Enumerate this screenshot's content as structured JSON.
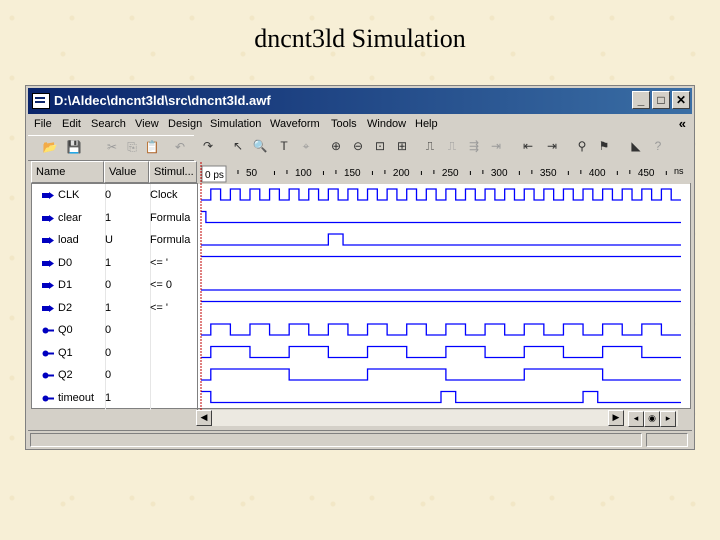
{
  "slide": {
    "title": "dncnt3ld Simulation"
  },
  "window": {
    "title": "D:\\Aldec\\dncnt3ld\\src\\dncnt3ld.awf",
    "buttons": {
      "minimize": "_",
      "maximize": "□",
      "close": "✕"
    }
  },
  "menu": [
    "File",
    "Edit",
    "Search",
    "View",
    "Design",
    "Simulation",
    "Waveform",
    "Tools",
    "Window",
    "Help"
  ],
  "menu_overflow": "«",
  "columns": {
    "name": "Name",
    "value": "Value",
    "stimulus": "Stimul..."
  },
  "timeline": {
    "cursor_label": "0 ps",
    "ticks": [
      "50",
      "100",
      "150",
      "200",
      "250",
      "300",
      "350",
      "400",
      "450"
    ],
    "unit": "ns"
  },
  "signals": [
    {
      "name": "CLK",
      "value": "0",
      "stimulus": "Clock",
      "direction": "in"
    },
    {
      "name": "clear",
      "value": "1",
      "stimulus": "Formula",
      "direction": "in"
    },
    {
      "name": "load",
      "value": "U",
      "stimulus": "Formula",
      "direction": "in"
    },
    {
      "name": "D0",
      "value": "1",
      "stimulus": "<= '",
      "direction": "in"
    },
    {
      "name": "D1",
      "value": "0",
      "stimulus": "<= 0",
      "direction": "in"
    },
    {
      "name": "D2",
      "value": "1",
      "stimulus": "<= '",
      "direction": "in"
    },
    {
      "name": "Q0",
      "value": "0",
      "stimulus": "",
      "direction": "out"
    },
    {
      "name": "Q1",
      "value": "0",
      "stimulus": "",
      "direction": "out"
    },
    {
      "name": "Q2",
      "value": "0",
      "stimulus": "",
      "direction": "out"
    },
    {
      "name": "timeout",
      "value": "1",
      "stimulus": "",
      "direction": "out"
    }
  ],
  "waveforms": {
    "time_range_ns": [
      0,
      490
    ],
    "CLK": {
      "type": "clock",
      "period_ns": 20,
      "start_level": 0
    },
    "clear": {
      "type": "edges",
      "initial": 1,
      "toggles_ns": [
        5
      ]
    },
    "load": {
      "type": "edges",
      "initial": 0,
      "toggles_ns": [
        130,
        145
      ]
    },
    "D0": {
      "type": "const",
      "level": 1
    },
    "D1": {
      "type": "const",
      "level": 0
    },
    "D2": {
      "type": "const",
      "level": 1
    },
    "Q0": {
      "type": "edges",
      "initial": 0,
      "toggles_ns": [
        10,
        30,
        50,
        70,
        90,
        110,
        130,
        150,
        170,
        190,
        210,
        230,
        250,
        270,
        290,
        310,
        330,
        350,
        370,
        390,
        410,
        430,
        450,
        470
      ]
    },
    "Q1": {
      "type": "edges",
      "initial": 0,
      "toggles_ns": [
        10,
        50,
        90,
        130,
        170,
        210,
        250,
        290,
        330,
        370,
        410,
        450
      ]
    },
    "Q2": {
      "type": "edges",
      "initial": 0,
      "toggles_ns": [
        10,
        90,
        170,
        250,
        330,
        410
      ]
    },
    "timeout": {
      "type": "edges",
      "initial": 1,
      "toggles_ns": [
        10,
        245,
        260,
        390,
        405
      ]
    }
  },
  "colors": {
    "titlebar": "#0a246a",
    "wave": "#0000ff",
    "cursor": "#c00000",
    "slide_bg": "#f7efd6"
  },
  "icons": {
    "toolbar_left": [
      "open-folder-icon",
      "save-icon",
      "cut-icon",
      "copy-icon",
      "paste-icon",
      "undo-icon",
      "redo-icon"
    ],
    "toolbar_wave": [
      "pointer-icon",
      "zoom-icon",
      "text-cursor-icon",
      "marker-icon",
      "zoom-in-icon",
      "zoom-out-icon",
      "zoom-area-icon",
      "zoom-fit-icon",
      "add-signal-icon",
      "remove-signal-icon",
      "bus-icon",
      "edge-icon",
      "prev-edge-icon",
      "next-edge-icon",
      "find-icon",
      "flag-icon",
      "bookmark-icon"
    ]
  }
}
